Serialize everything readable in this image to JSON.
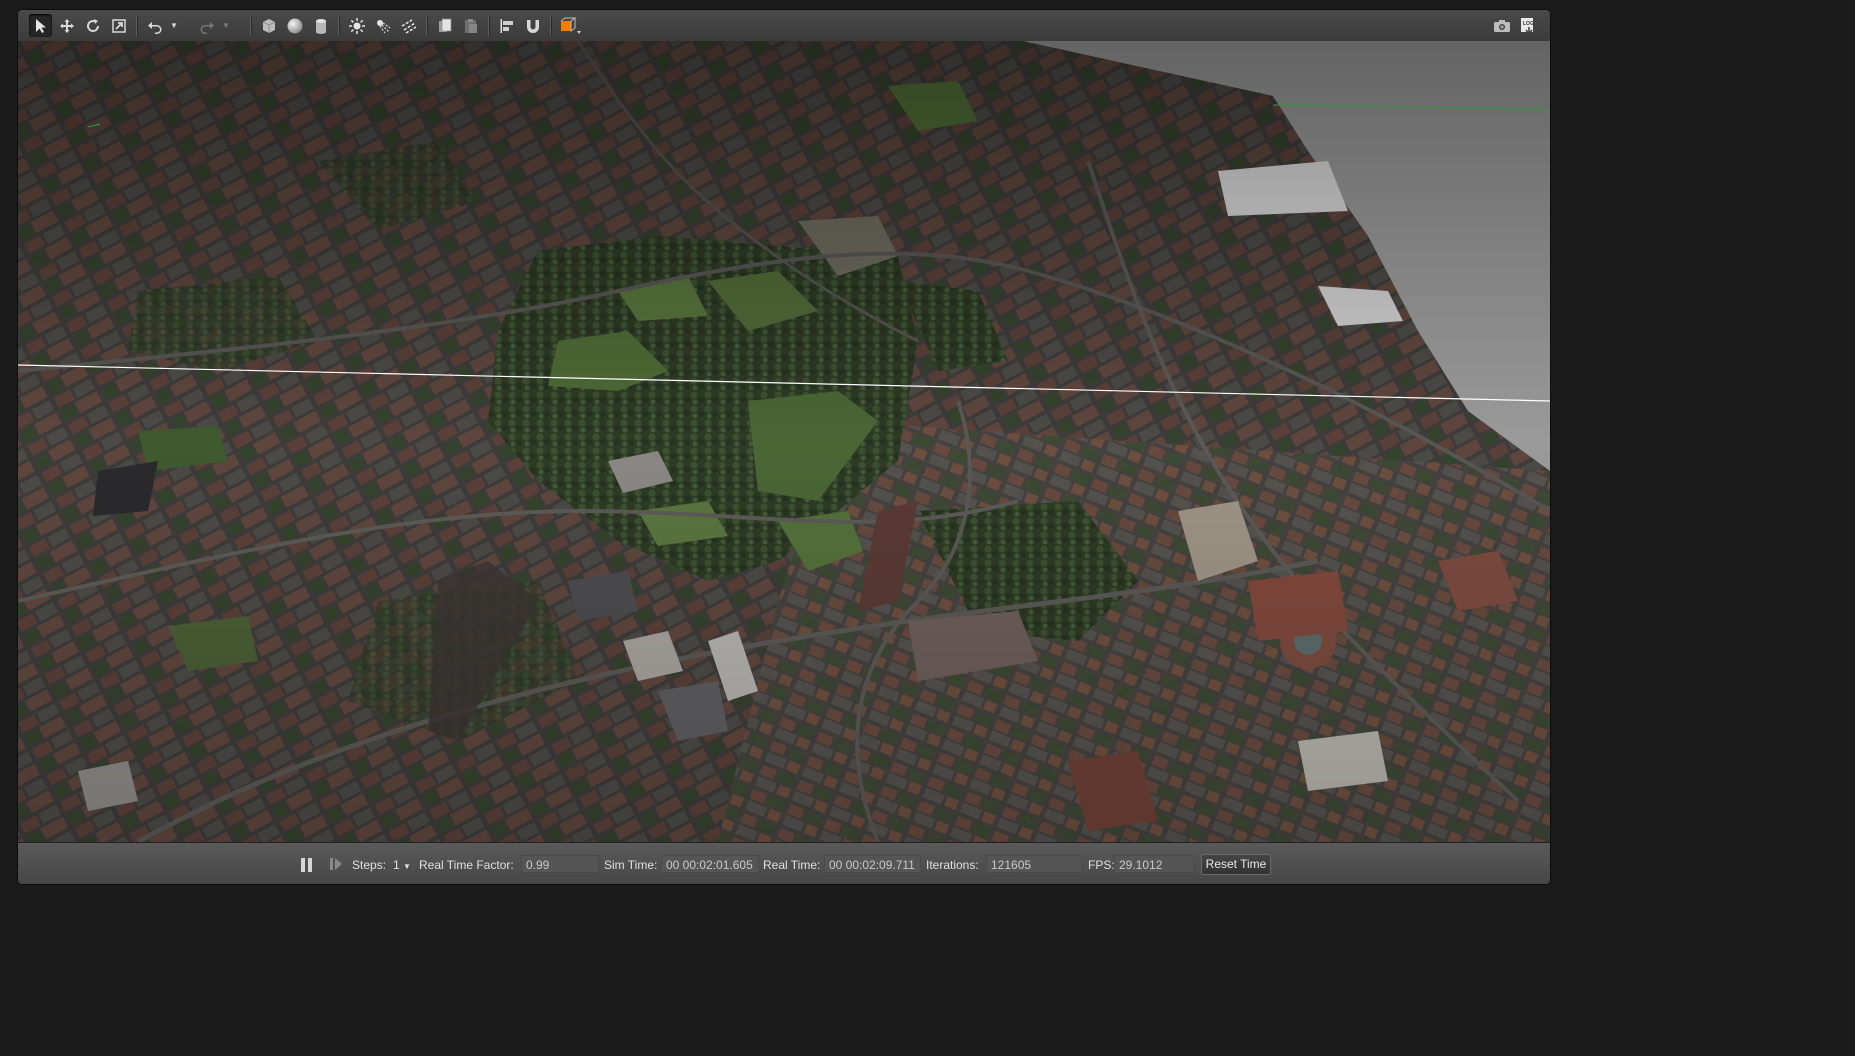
{
  "toolbar": {
    "tools": [
      {
        "name": "select-mode",
        "icon": "arrow-cursor-icon",
        "active": true
      },
      {
        "name": "translate-mode",
        "icon": "move-cross-icon"
      },
      {
        "name": "rotate-mode",
        "icon": "rotate-icon"
      },
      {
        "name": "scale-mode",
        "icon": "scale-icon"
      },
      {
        "name": "undo",
        "icon": "undo-icon"
      },
      {
        "name": "redo",
        "icon": "redo-icon"
      },
      {
        "name": "box-shape",
        "icon": "box-icon"
      },
      {
        "name": "sphere-shape",
        "icon": "sphere-icon"
      },
      {
        "name": "cylinder-shape",
        "icon": "cylinder-icon"
      },
      {
        "name": "point-light",
        "icon": "point-light-icon"
      },
      {
        "name": "spot-light",
        "icon": "spot-light-icon"
      },
      {
        "name": "directional-light",
        "icon": "directional-light-icon"
      },
      {
        "name": "copy",
        "icon": "copy-icon"
      },
      {
        "name": "paste",
        "icon": "paste-icon"
      },
      {
        "name": "align",
        "icon": "align-icon"
      },
      {
        "name": "snap",
        "icon": "magnet-icon"
      },
      {
        "name": "view-angle",
        "icon": "view-angle-icon"
      },
      {
        "name": "screenshot",
        "icon": "camera-icon"
      },
      {
        "name": "log",
        "icon": "log-icon"
      }
    ],
    "log_label": "LOG"
  },
  "status": {
    "steps_label": "Steps:",
    "steps_value": "1",
    "rtf_label": "Real Time Factor:",
    "rtf_value": "0.99",
    "sim_time_label": "Sim Time:",
    "sim_time_value": "00 00:02:01.605",
    "real_time_label": "Real Time:",
    "real_time_value": "00 00:02:09.711",
    "iterations_label": "Iterations:",
    "iterations_value": "121605",
    "fps_label": "FPS:",
    "fps_value": "29.1012",
    "reset_label": "Reset Time"
  },
  "colors": {
    "sky": "#9a9a9a",
    "grass": "#4f6b38",
    "roofs": "#6b4438",
    "horizon_line": "#ffffff",
    "accent_orange": "#f57c00"
  }
}
